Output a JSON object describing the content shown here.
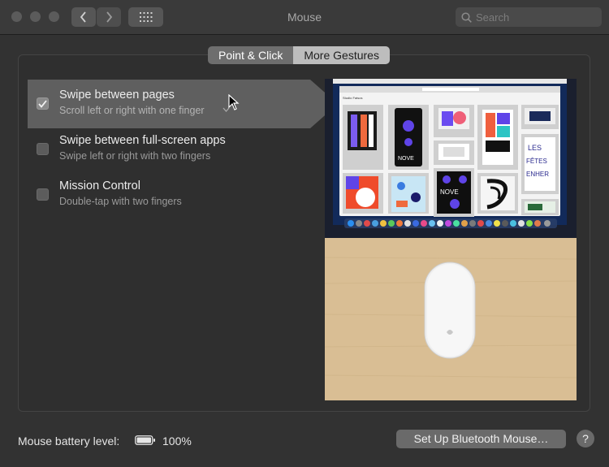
{
  "window": {
    "title": "Mouse"
  },
  "toolbar": {
    "search_placeholder": "Search"
  },
  "tabs": [
    {
      "label": "Point & Click",
      "selected": true
    },
    {
      "label": "More Gestures",
      "selected": false
    }
  ],
  "options": [
    {
      "title": "Swipe between pages",
      "subtitle": "Scroll left or right with one finger",
      "checked": true,
      "selected": true
    },
    {
      "title": "Swipe between full-screen apps",
      "subtitle": "Swipe left or right with two fingers",
      "checked": false,
      "selected": false
    },
    {
      "title": "Mission Control",
      "subtitle": "Double-tap with two fingers",
      "checked": false,
      "selected": false
    }
  ],
  "preview": {
    "app_title": "Studio Fatsos",
    "poster_text": [
      "NOVE",
      "NOVE",
      "LES",
      "FÊTES",
      "ENHER"
    ]
  },
  "footer": {
    "battery_label": "Mouse battery level:",
    "battery_value": "100%",
    "battery_level": 1.0,
    "setup_button": "Set Up Bluetooth Mouse…",
    "help_label": "?"
  },
  "colors": {
    "window_bg": "#323232",
    "selected_row": "#5f5f5f",
    "preview_desk": "#d8bd93",
    "preview_screen": "#14254a"
  }
}
